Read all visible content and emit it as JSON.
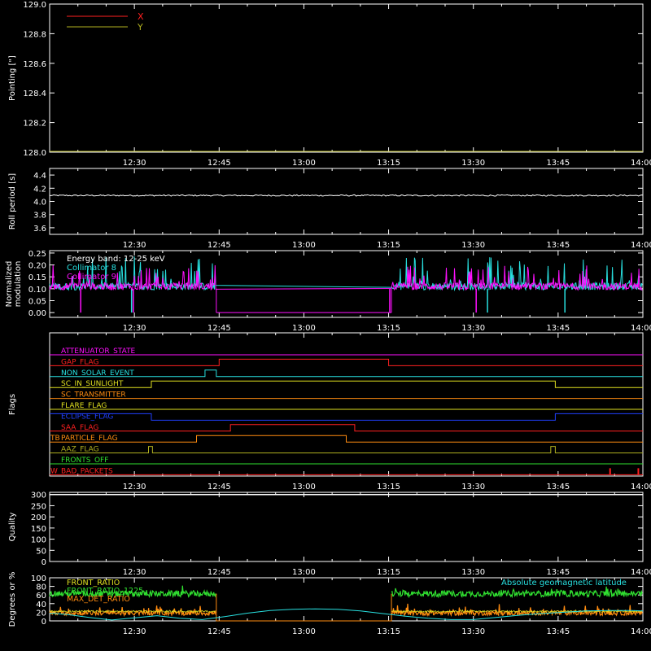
{
  "time_axis": {
    "start_min": 735,
    "end_min": 840,
    "ticks": [
      "12:30",
      "12:45",
      "13:00",
      "13:15",
      "13:30",
      "13:45",
      "14:00"
    ],
    "tick_minutes": [
      750,
      765,
      780,
      795,
      810,
      825,
      840
    ]
  },
  "colors": {
    "axis": "#ffffff",
    "x_series": "#ff2020",
    "y_series": "#b0b020",
    "cyan": "#28e0e0",
    "magenta": "#ff10ff",
    "green": "#30e030",
    "orange": "#ff8c10",
    "yellow": "#e0e020"
  },
  "chart_data": [
    {
      "id": "pointing",
      "type": "line",
      "ylabel": "Pointing [\"]",
      "ylim": [
        128.0,
        129.0
      ],
      "yticks": [
        "128.0",
        "128.2",
        "128.4",
        "128.6",
        "128.8",
        "129.0"
      ],
      "yticks_values": [
        128.0,
        128.2,
        128.4,
        128.6,
        128.8,
        129.0
      ],
      "legend": [
        {
          "name": "X",
          "color": "#ff2020"
        },
        {
          "name": "Y",
          "color": "#b0b020"
        }
      ],
      "series": [
        {
          "name": "Y",
          "color": "#b0b020",
          "x": [
            735,
            840
          ],
          "y": [
            128.0,
            128.0
          ]
        }
      ]
    },
    {
      "id": "roll",
      "type": "line",
      "ylabel": "Roll period [s]",
      "ylim": [
        3.5,
        4.5
      ],
      "yticks": [
        "3.6",
        "3.8",
        "4.0",
        "4.2",
        "4.4"
      ],
      "yticks_values": [
        3.6,
        3.8,
        4.0,
        4.2,
        4.4
      ],
      "series": [
        {
          "name": "roll",
          "color": "#ffffff",
          "x": [
            735,
            750,
            765,
            780,
            795,
            810,
            825,
            840
          ],
          "y": [
            4.09,
            4.09,
            4.1,
            4.09,
            4.09,
            4.09,
            4.09,
            4.09
          ]
        }
      ]
    },
    {
      "id": "modulation",
      "type": "line",
      "ylabel_lines": [
        "Normalized",
        "modulation"
      ],
      "ylim": [
        -0.02,
        0.26
      ],
      "yticks": [
        "0.00",
        "0.05",
        "0.10",
        "0.15",
        "0.20",
        "0.25"
      ],
      "yticks_values": [
        0.0,
        0.05,
        0.1,
        0.15,
        0.2,
        0.25
      ],
      "legend": [
        {
          "name": "Energy band: 12-25 keV",
          "color": "#ffffff"
        },
        {
          "name": "Collimator 8",
          "color": "#28e0e0"
        },
        {
          "name": "Collimator 9",
          "color": "#ff10ff"
        }
      ],
      "base_level": 0.1,
      "active_ranges": [
        [
          735,
          764.5
        ],
        [
          795.5,
          840
        ]
      ],
      "dips_cyan": [
        749.5,
        812.5,
        826.2
      ],
      "dips_magenta": [
        740.5,
        749.8,
        795.2,
        810.5
      ]
    },
    {
      "id": "flags",
      "type": "table",
      "ylabel": "Flags",
      "flags": [
        {
          "label": "ATTENUATOR_STATE",
          "color": "#ff10ff",
          "steps": []
        },
        {
          "label": "GAP_FLAG",
          "color": "#ff2020",
          "steps": [
            [
              765,
              795
            ]
          ]
        },
        {
          "label": "NON_SOLAR_EVENT",
          "color": "#28e0e0",
          "steps": [
            [
              762.5,
              764.5
            ]
          ]
        },
        {
          "label": "SC_IN_SUNLIGHT",
          "color": "#e0e020",
          "steps": [
            [
              753,
              824.5
            ]
          ],
          "invert": true
        },
        {
          "label": "SC_TRANSMITTER",
          "color": "#ff8c10",
          "steps": []
        },
        {
          "label": "FLARE_FLAG",
          "color": "#e0e020",
          "steps": []
        },
        {
          "label": "ECLIPSE_FLAG",
          "color": "#2040ff",
          "steps": [
            [
              753,
              824.5
            ]
          ]
        },
        {
          "label": "SAA_FLAG",
          "color": "#ff2020",
          "steps": [
            [
              767,
              789
            ]
          ]
        },
        {
          "label": "PARTICLE_FLAG",
          "color": "#ff8c10",
          "steps": [
            [
              761,
              787.5
            ]
          ],
          "prefix": "TB"
        },
        {
          "label": "AAZ_FLAG",
          "color": "#b0b020",
          "steps": [
            [
              752.5,
              753.2
            ],
            [
              823.7,
              824.5
            ]
          ]
        },
        {
          "label": "FRONTS_OFF",
          "color": "#30e030",
          "steps": []
        },
        {
          "label": "BAD_PACKETS",
          "color": "#ff2020",
          "steps": [],
          "spikes": [
            834.2,
            839.2
          ],
          "prefix": "W"
        }
      ]
    },
    {
      "id": "quality",
      "type": "line",
      "ylabel": "Quality",
      "ylim": [
        0,
        310
      ],
      "yticks": [
        "0",
        "50",
        "100",
        "150",
        "200",
        "250",
        "300"
      ],
      "yticks_values": [
        0,
        50,
        100,
        150,
        200,
        250,
        300
      ],
      "series": [
        {
          "name": "quality",
          "color": "#ffffff",
          "x": [
            735,
            840
          ],
          "y": [
            300,
            300
          ]
        }
      ]
    },
    {
      "id": "ratios",
      "type": "line",
      "ylabel": "Degrees or %",
      "ylim": [
        0,
        100
      ],
      "yticks": [
        "0",
        "20",
        "40",
        "60",
        "80",
        "100"
      ],
      "yticks_values": [
        0,
        20,
        40,
        60,
        80,
        100
      ],
      "legend": [
        {
          "name": "FRONT_RATIO",
          "color": "#e0e020"
        },
        {
          "name": "FRONT_RATIO_1225",
          "color": "#30e030"
        },
        {
          "name": "MAX_DET_RATIO",
          "color": "#ff8c10"
        }
      ],
      "annotation": {
        "text": "Absolute geomagnetic latitude",
        "color": "#28e0e0"
      },
      "active_ranges": [
        [
          735,
          764.5
        ],
        [
          795.5,
          840
        ]
      ],
      "green_level": 63,
      "orange_level": 18,
      "latitude": {
        "x": [
          735,
          738,
          742,
          746,
          750,
          754,
          758,
          762,
          766,
          770,
          774,
          778,
          782,
          786,
          790,
          794,
          798,
          802,
          806,
          810,
          814,
          818,
          822,
          826,
          830,
          834,
          838,
          840
        ],
        "y": [
          18,
          15,
          8,
          2,
          7,
          12,
          6,
          3,
          10,
          18,
          24,
          27,
          28,
          27,
          23,
          17,
          11,
          6,
          3,
          3,
          8,
          13,
          17,
          20,
          23,
          24,
          24,
          23
        ]
      }
    }
  ]
}
